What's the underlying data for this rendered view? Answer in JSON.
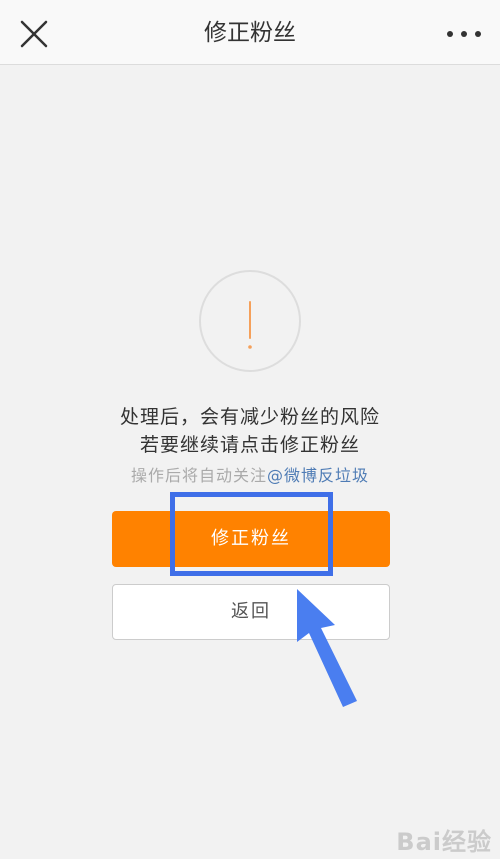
{
  "header": {
    "title": "修正粉丝",
    "close_icon": "close-icon",
    "more_icon": "more-icon"
  },
  "warning": {
    "icon": "exclamation-icon",
    "line1": "处理后，会有减少粉丝的风险",
    "line2": "若要继续请点击修正粉丝",
    "follow_prefix": "操作后将自动关注",
    "follow_link": "@微博反垃圾"
  },
  "buttons": {
    "primary_label": "修正粉丝",
    "secondary_label": "返回"
  },
  "annotation": {
    "highlight_color": "#3f6fe8",
    "arrow_color": "#4a7ef0"
  },
  "watermark": "Bai经验",
  "colors": {
    "accent": "#ff8200",
    "link": "#4f7cb5",
    "warning_mark": "#f5a05a"
  }
}
